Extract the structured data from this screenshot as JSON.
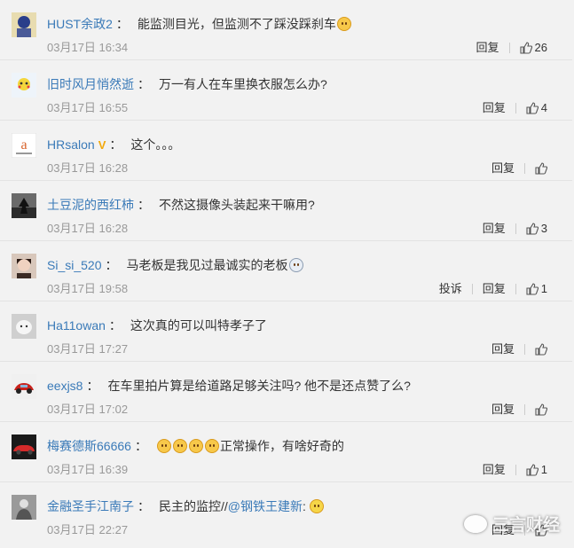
{
  "comments": [
    {
      "user": "HUST余政2",
      "text": "能监测目光，但监测不了踩没踩刹车",
      "emojis": [
        "doge"
      ],
      "time": "03月17日 16:34",
      "reply": "回复",
      "likes": "26"
    },
    {
      "user": "旧时风月悄然逝",
      "text": "万一有人在车里换衣服怎么办?",
      "emojis": [],
      "time": "03月17日 16:55",
      "reply": "回复",
      "likes": "4"
    },
    {
      "user": "HRsalon",
      "text": "这个。。。",
      "emojis": [],
      "time": "03月17日 16:28",
      "reply": "回复",
      "likes": ""
    },
    {
      "user": "土豆泥的西红柿",
      "text": "不然这摄像头装起来干嘛用?",
      "emojis": [],
      "time": "03月17日 16:28",
      "reply": "回复",
      "likes": "3"
    },
    {
      "user": "Si_si_520",
      "text": "马老板是我见过最诚实的老板",
      "emojis": [
        "cry"
      ],
      "time": "03月17日 19:58",
      "report": "投诉",
      "reply": "回复",
      "likes": "1"
    },
    {
      "user": "Ha11owan",
      "text": "这次真的可以叫特孝子了",
      "emojis": [],
      "time": "03月17日 17:27",
      "reply": "回复",
      "likes": ""
    },
    {
      "user": "eexjs8",
      "text": "在车里拍片算是给道路足够关注吗? 他不是还点赞了么?",
      "emojis": [],
      "time": "03月17日 17:02",
      "reply": "回复",
      "likes": ""
    },
    {
      "user": "梅赛德斯66666",
      "text": "正常操作，有啥好奇的",
      "emojis_before": [
        "doge",
        "doge",
        "doge",
        "doge"
      ],
      "time": "03月17日 16:39",
      "reply": "回复",
      "likes": "1"
    },
    {
      "user": "金融圣手江南子",
      "text": "民主的监控//",
      "mention": "@钢铁王建新",
      "mention_suffix": ":",
      "emojis": [
        "laugh"
      ],
      "time": "03月17日 22:27",
      "reply": "回复",
      "likes": ""
    }
  ],
  "watermark": "三言财经",
  "colors": {
    "username": "#eb7350",
    "link": "#3a7ab8",
    "meta": "#999999",
    "background": "#f2f2f2"
  }
}
